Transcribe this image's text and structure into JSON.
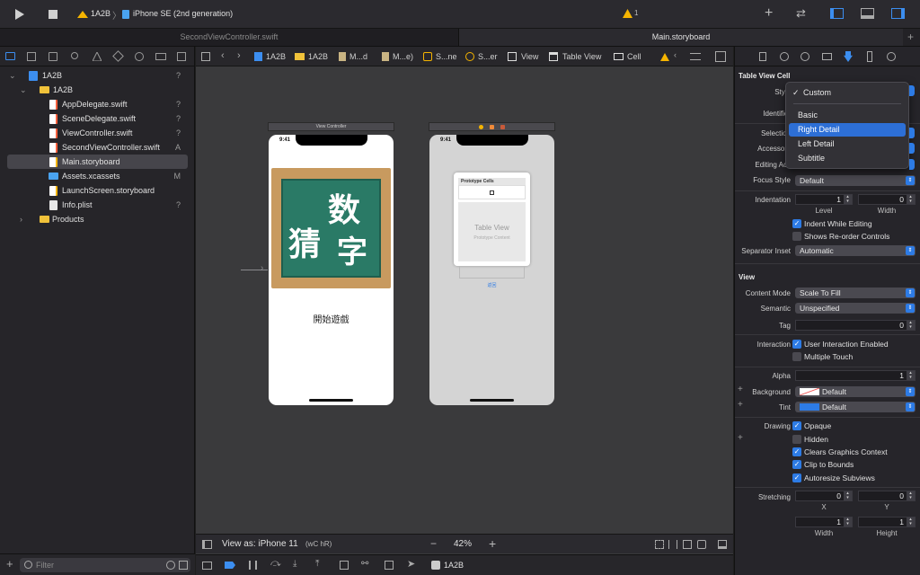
{
  "toolbar": {
    "scheme": "1A2B",
    "device": "iPhone SE (2nd generation)",
    "warning_count": "1"
  },
  "tabs": [
    {
      "label": "SecondViewController.swift"
    },
    {
      "label": "Main.storyboard"
    }
  ],
  "navigator": {
    "items": [
      {
        "label": "1A2B",
        "status": "?"
      },
      {
        "label": "1A2B",
        "status": ""
      },
      {
        "label": "AppDelegate.swift",
        "status": "?"
      },
      {
        "label": "SceneDelegate.swift",
        "status": "?"
      },
      {
        "label": "ViewController.swift",
        "status": "?"
      },
      {
        "label": "SecondViewController.swift",
        "status": "A"
      },
      {
        "label": "Main.storyboard",
        "status": ""
      },
      {
        "label": "Assets.xcassets",
        "status": "M"
      },
      {
        "label": "LaunchScreen.storyboard",
        "status": ""
      },
      {
        "label": "Info.plist",
        "status": "?"
      },
      {
        "label": "Products",
        "status": ""
      }
    ],
    "filter_placeholder": "Filter"
  },
  "jumpbar": {
    "crumbs": [
      "1A2B",
      "1A2B",
      "M...d",
      "M...e)",
      "S...ne",
      "S...er",
      "View",
      "Table View",
      "Cell"
    ]
  },
  "scene1": {
    "title": "View Controller",
    "time": "9:41",
    "button": "開始遊戲",
    "image_text_1": "数",
    "image_text_2": "猜",
    "image_text_3": "字"
  },
  "scene2": {
    "time": "9:41",
    "prototype_label": "Prototype Cells",
    "table_title": "Table View",
    "table_sub": "Prototype Content",
    "link": "返回"
  },
  "bottom": {
    "view_as": "View as: iPhone 11",
    "size_class": "(wC hR)",
    "zoom": "42%",
    "debug_target": "1A2B"
  },
  "inspector": {
    "section_cell": "Table View Cell",
    "style_label": "Style",
    "identifier_label": "Identifier",
    "selection_label": "Selection",
    "accessory_label": "Accessory",
    "editing_acc_label": "Editing Acc",
    "focus_label": "Focus Style",
    "focus_value": "Default",
    "indent_label": "Indentation",
    "indent_level": "1",
    "indent_width": "0",
    "level_label": "Level",
    "width_label": "Width",
    "indent_editing": "Indent While Editing",
    "reorder": "Shows Re-order Controls",
    "sep_label": "Separator Inset",
    "sep_value": "Automatic",
    "section_view": "View",
    "content_mode_label": "Content Mode",
    "content_mode": "Scale To Fill",
    "semantic_label": "Semantic",
    "semantic": "Unspecified",
    "tag_label": "Tag",
    "tag": "0",
    "interaction_label": "Interaction",
    "user_interaction": "User Interaction Enabled",
    "multi_touch": "Multiple Touch",
    "alpha_label": "Alpha",
    "alpha": "1",
    "background_label": "Background",
    "background": "Default",
    "tint_label": "Tint",
    "tint": "Default",
    "drawing_label": "Drawing",
    "opaque": "Opaque",
    "hidden": "Hidden",
    "clears": "Clears Graphics Context",
    "clip": "Clip to Bounds",
    "autoresize": "Autoresize Subviews",
    "stretching_label": "Stretching",
    "stretch_x": "0",
    "stretch_y": "0",
    "stretch_w": "1",
    "stretch_h": "1",
    "x_label": "X",
    "y_label": "Y",
    "w_label": "Width",
    "h_label": "Height"
  },
  "dropdown": {
    "items": [
      "Custom",
      "Basic",
      "Right Detail",
      "Left Detail",
      "Subtitle"
    ],
    "checked": "Custom",
    "highlighted": "Right Detail"
  },
  "colors": {
    "accent": "#2d7be5",
    "warning": "#f5b400"
  }
}
